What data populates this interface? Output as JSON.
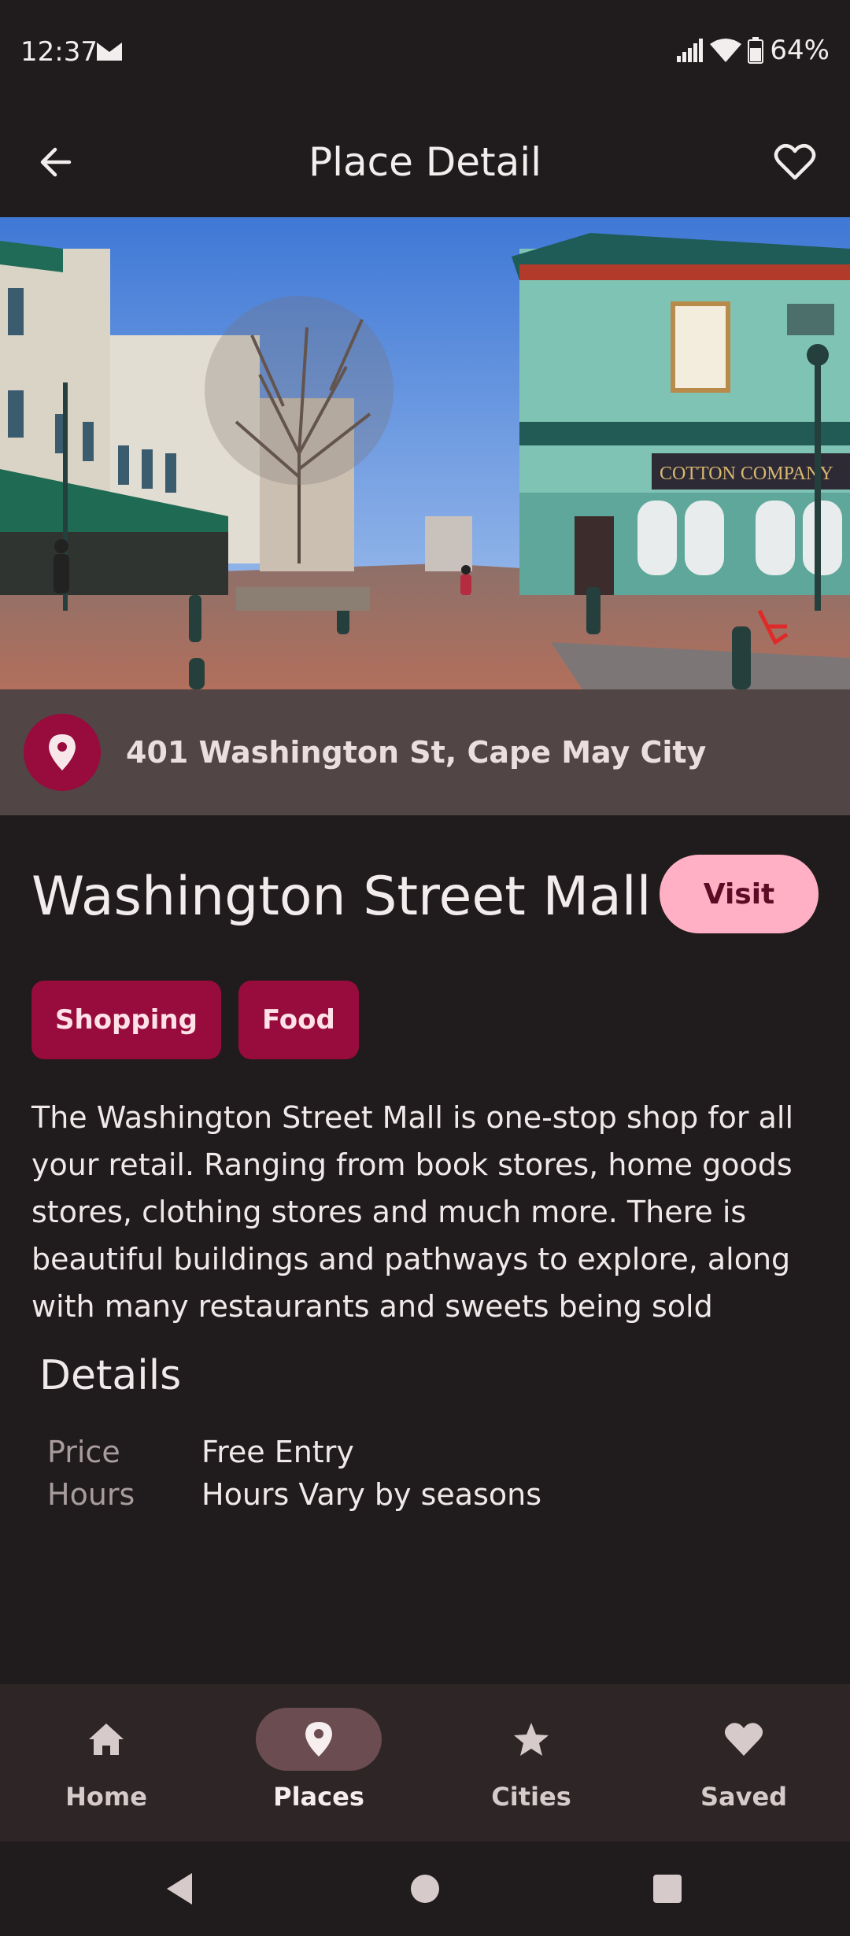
{
  "status_bar": {
    "time": "12:37",
    "battery": "64%"
  },
  "top_bar": {
    "title": "Place Detail"
  },
  "address": {
    "text": "401 Washington St, Cape May City"
  },
  "place": {
    "name": "Washington Street Mall",
    "visit_label": "Visit",
    "tags": [
      "Shopping",
      "Food"
    ],
    "description": "The Washington Street Mall is one-stop shop for all your retail. Ranging from book stores, home goods stores, clothing stores and much more. There is beautiful buildings and pathways to explore, along with many restaurants and sweets being sold"
  },
  "details": {
    "heading": "Details",
    "rows": [
      {
        "label": "Price",
        "value": "Free Entry"
      },
      {
        "label": "Hours",
        "value": "Hours Vary by seasons"
      }
    ]
  },
  "hero_sign_text": "COTTON COMPANY",
  "bottom_nav": {
    "items": [
      {
        "label": "Home",
        "icon": "home-icon",
        "active": false
      },
      {
        "label": "Places",
        "icon": "pin-icon",
        "active": true
      },
      {
        "label": "Cities",
        "icon": "star-icon",
        "active": false
      },
      {
        "label": "Saved",
        "icon": "heart-icon",
        "active": false
      }
    ]
  },
  "colors": {
    "background": "#201b1c",
    "accent": "#970b3d",
    "visit_button": "#ffb0c4",
    "address_bar": "#524546"
  }
}
